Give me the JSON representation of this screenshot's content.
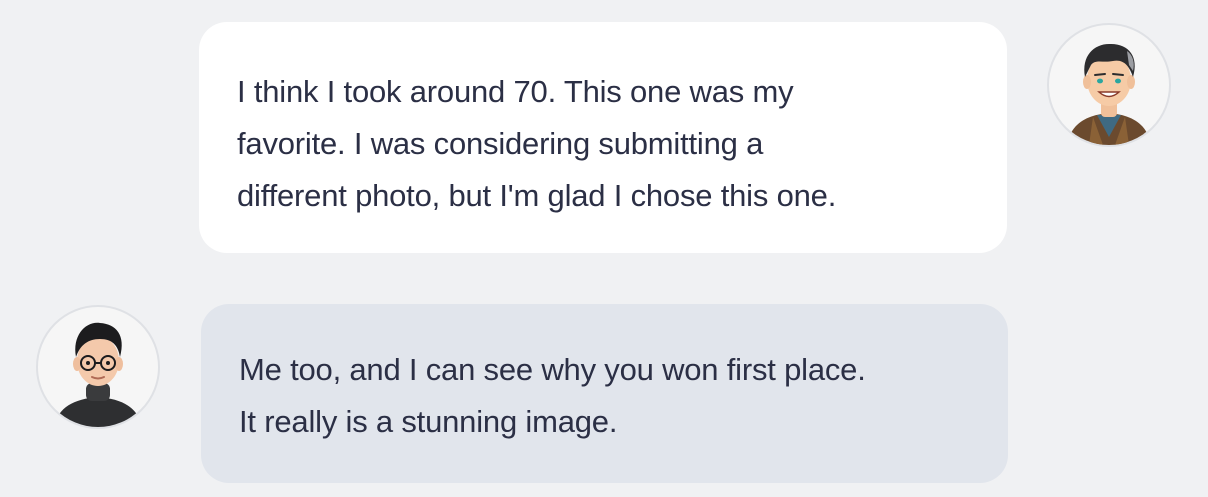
{
  "chat": {
    "messages": [
      {
        "direction": "sent",
        "avatar_icon": "man-with-jacket-avatar",
        "lines": [
          "I think I took around 70. This one was my",
          "favorite. I was considering submitting a",
          "different photo, but I'm glad I chose this one."
        ]
      },
      {
        "direction": "received",
        "avatar_icon": "man-with-glasses-avatar",
        "lines": [
          "Me too, and I can see why you won first place.",
          "It really is a stunning image."
        ]
      }
    ]
  },
  "colors": {
    "background": "#f0f1f3",
    "sent_bubble": "#ffffff",
    "received_bubble": "#e1e5ec",
    "text": "#2b2f45"
  }
}
